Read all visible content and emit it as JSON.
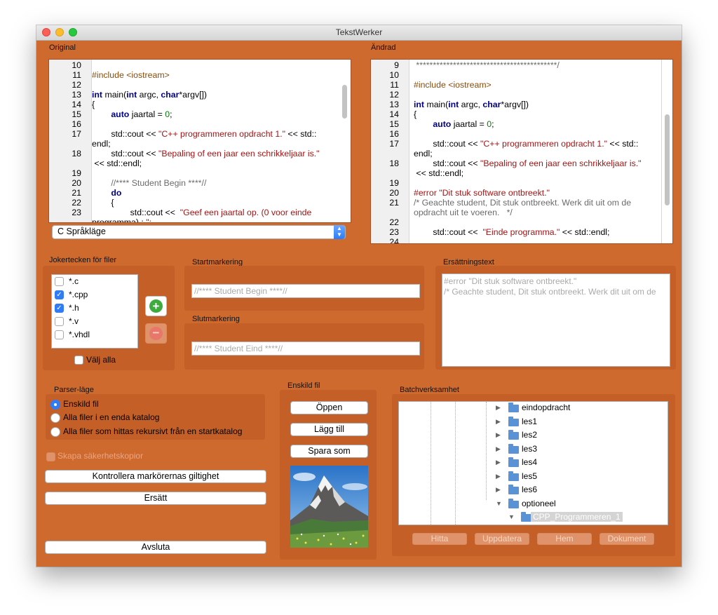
{
  "window": {
    "title": "TekstWerker"
  },
  "original": {
    "label": "Original",
    "lines": [
      {
        "n": "10",
        "t": ""
      },
      {
        "n": "11",
        "t": "#include <iostream>"
      },
      {
        "n": "12",
        "t": ""
      },
      {
        "n": "13",
        "t": "int main(int argc, char*argv[])"
      },
      {
        "n": "14",
        "t": "{"
      },
      {
        "n": "15",
        "t": "        auto jaartal = 0;"
      },
      {
        "n": "16",
        "t": ""
      },
      {
        "n": "17",
        "t": "        std::cout << \"C++ programmeren opdracht 1.\" << std::"
      },
      {
        "n": "",
        "t": "endl;"
      },
      {
        "n": "18",
        "t": "        std::cout << \"Bepaling of een jaar een schrikkeljaar is.\""
      },
      {
        "n": "",
        "t": " << std::endl;"
      },
      {
        "n": "19",
        "t": ""
      },
      {
        "n": "20",
        "t": "        //**** Student Begin ****//"
      },
      {
        "n": "21",
        "t": "        do"
      },
      {
        "n": "22",
        "t": "        {"
      },
      {
        "n": "23",
        "t": "                std::cout <<  \"Geef een jaartal op. (0 voor einde"
      },
      {
        "n": "",
        "t": "programma) : \";"
      }
    ],
    "language_select": "C Språkläge"
  },
  "changed": {
    "label": "Ändrad",
    "lines": [
      {
        "n": "9",
        "t": " ******************************************/"
      },
      {
        "n": "10",
        "t": ""
      },
      {
        "n": "11",
        "t": "#include <iostream>"
      },
      {
        "n": "12",
        "t": ""
      },
      {
        "n": "13",
        "t": "int main(int argc, char*argv[])"
      },
      {
        "n": "14",
        "t": "{"
      },
      {
        "n": "15",
        "t": "        auto jaartal = 0;"
      },
      {
        "n": "16",
        "t": ""
      },
      {
        "n": "17",
        "t": "        std::cout << \"C++ programmeren opdracht 1.\" << std::"
      },
      {
        "n": "",
        "t": "endl;"
      },
      {
        "n": "18",
        "t": "        std::cout << \"Bepaling of een jaar een schrikkeljaar is.\""
      },
      {
        "n": "",
        "t": " << std::endl;"
      },
      {
        "n": "19",
        "t": ""
      },
      {
        "n": "20",
        "t": "#error \"Dit stuk software ontbreekt.\""
      },
      {
        "n": "21",
        "t": "/* Geachte student, Dit stuk ontbreekt. Werk dit uit om de"
      },
      {
        "n": "",
        "t": "opdracht uit te voeren.   */"
      },
      {
        "n": "22",
        "t": ""
      },
      {
        "n": "23",
        "t": "        std::cout <<  \"Einde programma.\" << std::endl;"
      },
      {
        "n": "24",
        "t": ""
      }
    ]
  },
  "wildcards": {
    "label": "Jokertecken för filer",
    "items": [
      {
        "label": "*.c",
        "checked": false
      },
      {
        "label": "*.cpp",
        "checked": true
      },
      {
        "label": "*.h",
        "checked": true
      },
      {
        "label": "*.v",
        "checked": false
      },
      {
        "label": "*.vhdl",
        "checked": false
      }
    ],
    "select_all": "Välj alla"
  },
  "start_marker": {
    "label": "Startmarkering",
    "placeholder": "//**** Student Begin ****//"
  },
  "end_marker": {
    "label": "Slutmarkering",
    "placeholder": "//**** Student Eind ****//"
  },
  "replacement": {
    "label": "Ersättningstext",
    "line1": "#error \"Dit stuk software ontbreekt.\"",
    "line2": "/* Geachte student, Dit stuk ontbreekt. Werk dit uit om de"
  },
  "parser": {
    "label": "Parser-läge",
    "options": [
      "Enskild fil",
      "Alla filer i en enda katalog",
      "Alla filer som hittas rekursivt från en startkatalog"
    ],
    "backup": "Skapa säkerhetskopior",
    "validate": "Kontrollera markörernas giltighet",
    "replace": "Ersätt",
    "quit": "Avsluta"
  },
  "single_file": {
    "label": "Enskild fil",
    "open": "Öppen",
    "add": "Lägg till",
    "save_as": "Spara som"
  },
  "batch": {
    "label": "Batchverksamhet",
    "tree": [
      "eindopdracht",
      "les1",
      "les2",
      "les3",
      "les4",
      "les5",
      "les6",
      "optioneel",
      "CPP_Programmeren_1"
    ],
    "buttons": [
      "Hitta",
      "Uppdatera",
      "Hem",
      "Dokument"
    ]
  },
  "colors": {
    "window_bg": "#cf6a2e",
    "accent": "#2f7cf6"
  }
}
